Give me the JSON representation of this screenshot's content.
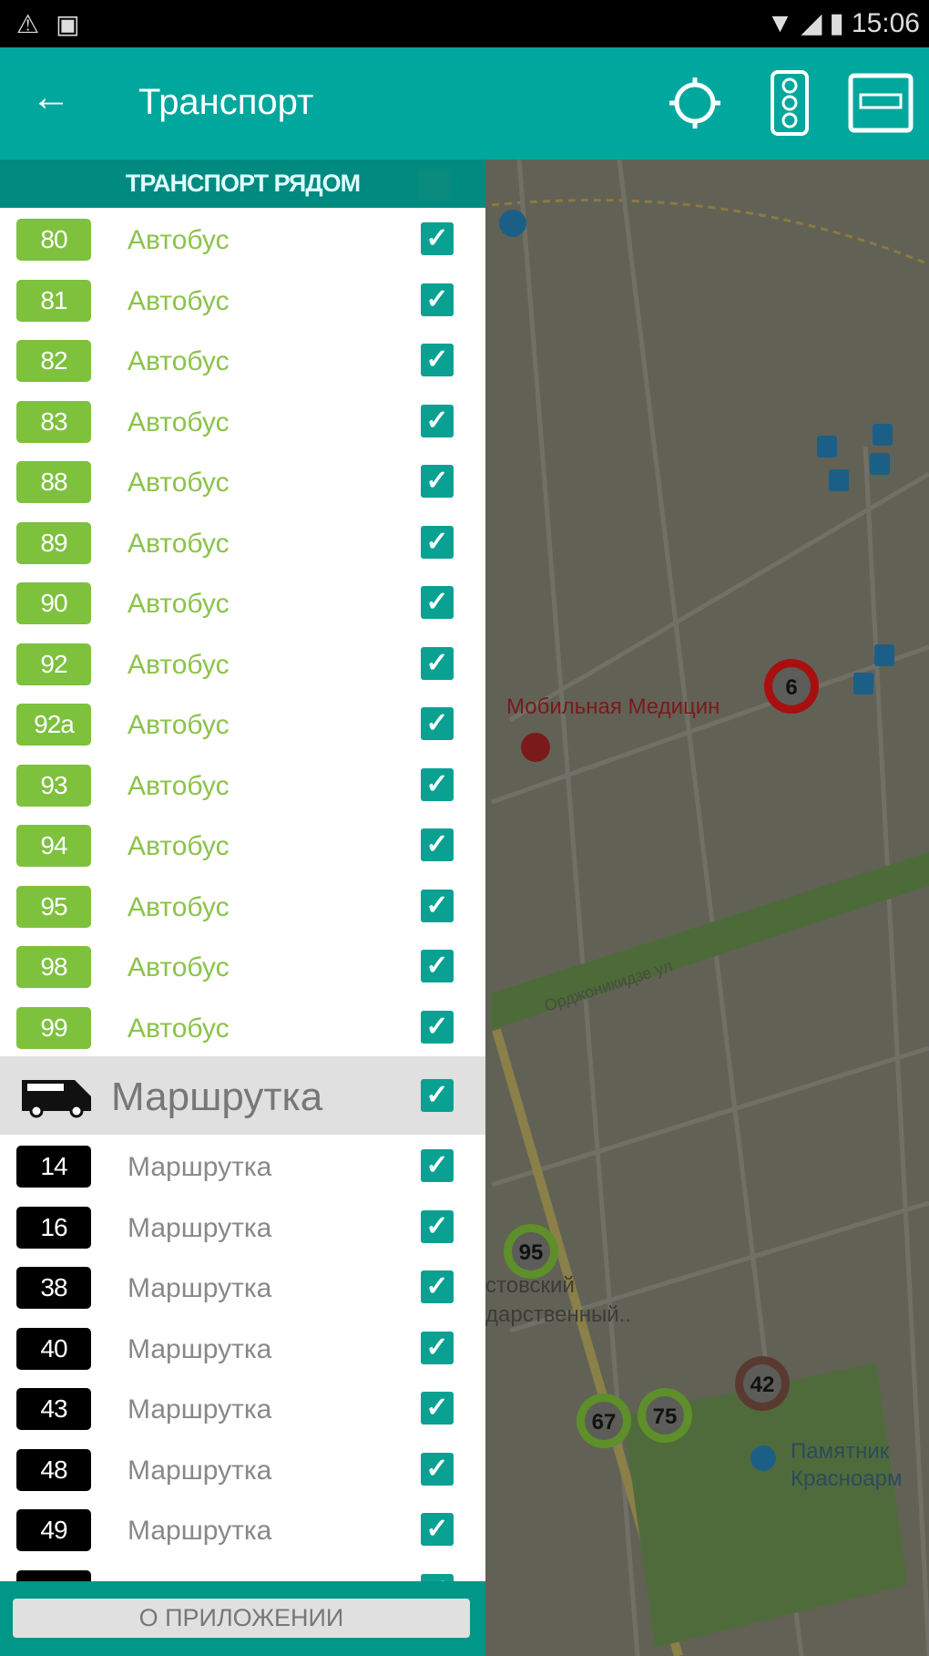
{
  "status_bar": {
    "time": "15:06",
    "icons": [
      "warning-icon",
      "image-icon",
      "wifi-icon",
      "signal-icon",
      "battery-icon"
    ]
  },
  "app_bar": {
    "title": "Транспорт",
    "back_icon": "arrow-left-icon",
    "actions": [
      "locate-icon",
      "traffic-light-icon",
      "bus-stop-icon"
    ]
  },
  "panel": {
    "header": "ТРАНСПОРТ РЯДОМ",
    "bus_routes": [
      {
        "num": "80",
        "type": "Автобус"
      },
      {
        "num": "81",
        "type": "Автобус"
      },
      {
        "num": "82",
        "type": "Автобус"
      },
      {
        "num": "83",
        "type": "Автобус"
      },
      {
        "num": "88",
        "type": "Автобус"
      },
      {
        "num": "89",
        "type": "Автобус"
      },
      {
        "num": "90",
        "type": "Автобус"
      },
      {
        "num": "92",
        "type": "Автобус"
      },
      {
        "num": "92а",
        "type": "Автобус"
      },
      {
        "num": "93",
        "type": "Автобус"
      },
      {
        "num": "94",
        "type": "Автобус"
      },
      {
        "num": "95",
        "type": "Автобус"
      },
      {
        "num": "98",
        "type": "Автобус"
      },
      {
        "num": "99",
        "type": "Автобус"
      }
    ],
    "minibus_group": {
      "label": "Маршрутка",
      "icon": "minibus-icon",
      "checked": true
    },
    "minibus_routes": [
      {
        "num": "14",
        "type": "Маршрутка"
      },
      {
        "num": "16",
        "type": "Маршрутка"
      },
      {
        "num": "38",
        "type": "Маршрутка"
      },
      {
        "num": "40",
        "type": "Маршрутка"
      },
      {
        "num": "43",
        "type": "Маршрутка"
      },
      {
        "num": "48",
        "type": "Маршрутка"
      },
      {
        "num": "49",
        "type": "Маршрутка"
      },
      {
        "num": "",
        "type": ""
      }
    ],
    "about_button": "О ПРИЛОЖЕНИИ"
  },
  "map": {
    "labels": {
      "poi1": "Мобильная Медицин",
      "street": "Орджоникидзе ул",
      "poi2a": "стовский",
      "poi2b": "дарственный..",
      "poi3a": "Памятник",
      "poi3b": "Красноарм"
    },
    "markers": [
      {
        "num": "6",
        "color": "#a80f0f"
      },
      {
        "num": "95",
        "color": "#5e8f2a"
      },
      {
        "num": "67",
        "color": "#5e8f2a"
      },
      {
        "num": "75",
        "color": "#5e8f2a"
      },
      {
        "num": "42",
        "color": "#5a3a30"
      }
    ]
  },
  "colors": {
    "primary": "#00a79d",
    "bus": "#7dc13c",
    "minibus": "#000000",
    "checkbox": "#0aa193"
  }
}
